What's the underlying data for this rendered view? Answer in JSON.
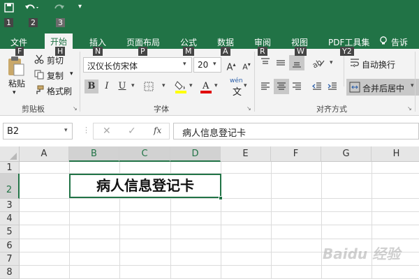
{
  "qat": {
    "save_tip": "1",
    "undo_tip": "2",
    "redo_tip": "3"
  },
  "tabs": [
    {
      "label": "文件",
      "keytip": "F"
    },
    {
      "label": "开始",
      "keytip": "H"
    },
    {
      "label": "插入",
      "keytip": "N"
    },
    {
      "label": "页面布局",
      "keytip": "P"
    },
    {
      "label": "公式",
      "keytip": "M"
    },
    {
      "label": "数据",
      "keytip": "A"
    },
    {
      "label": "审阅",
      "keytip": "R"
    },
    {
      "label": "视图",
      "keytip": "W"
    },
    {
      "label": "PDF工具集",
      "keytip": "Y2"
    },
    {
      "label": "告诉"
    }
  ],
  "clipboard": {
    "paste": "粘贴",
    "cut": "剪切",
    "copy": "复制",
    "format_painter": "格式刷",
    "group": "剪贴板"
  },
  "font": {
    "name": "汉仪长仿宋体",
    "size": "20",
    "bold": "B",
    "italic": "I",
    "underline": "U",
    "grow": "A",
    "shrink": "A",
    "phonetic": "wén",
    "group": "字体",
    "fill_color": "#ffff00",
    "font_color": "#e00000"
  },
  "alignment": {
    "wrap": "自动换行",
    "merge": "合并后居中",
    "group": "对齐方式"
  },
  "formula_bar": {
    "name_box": "B2",
    "fx": "fx",
    "value": "病人信息登记卡"
  },
  "sheet": {
    "columns": [
      "A",
      "B",
      "C",
      "D",
      "E",
      "F",
      "G",
      "H"
    ],
    "rows": [
      "1",
      "2",
      "3",
      "4",
      "5",
      "6",
      "7",
      "8"
    ],
    "merged_cell_text": "病人信息登记卡"
  },
  "watermark": "Baidu 经验",
  "colors": {
    "accent": "#217346"
  }
}
